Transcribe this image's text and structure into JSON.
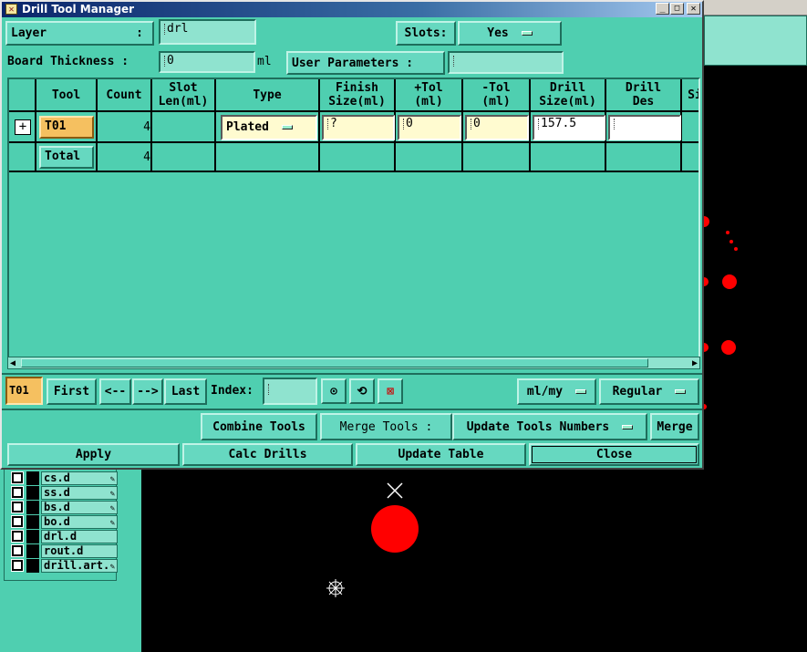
{
  "window": {
    "title": "Drill Tool Manager"
  },
  "top": {
    "layer_label": "Layer",
    "layer_colon": ":",
    "layer_value": "drl",
    "slots_label": "Slots:",
    "slots_value": "Yes",
    "board_thickness_label": "Board Thickness :",
    "board_thickness_value": "0",
    "board_thickness_unit": "ml",
    "user_params_label": "User Parameters :",
    "user_params_value": ""
  },
  "table": {
    "headers": [
      "Tool",
      "Count",
      "Slot\nLen(ml)",
      "Type",
      "Finish\nSize(ml)",
      "+Tol\n(ml)",
      "-Tol\n(ml)",
      "Drill\nSize(ml)",
      "Drill\nDes",
      "Si"
    ],
    "rows": [
      {
        "tool": "T01",
        "count": "4",
        "slot_len": "",
        "type": "Plated",
        "finish": "?",
        "plus_tol": "0",
        "minus_tol": "0",
        "drill_size": "157.5",
        "drill_des": ""
      },
      {
        "tool": "Total",
        "count": "4"
      }
    ]
  },
  "nav": {
    "current": "T01",
    "first": "First",
    "prev": "<--",
    "next": "-->",
    "last": "Last",
    "index_label": "Index:",
    "index_value": "",
    "units": "ml/my",
    "mode": "Regular"
  },
  "actions": {
    "combine_tools": "Combine Tools",
    "merge_tools_label": "Merge Tools :",
    "merge_tools_option": "Update Tools Numbers",
    "merge": "Merge",
    "apply": "Apply",
    "calc_drills": "Calc Drills",
    "update_table": "Update Table",
    "close": "Close"
  },
  "layers": [
    "cs.d",
    "ss.d",
    "bs.d",
    "bo.d",
    "drl.d",
    "rout.d",
    "drill.art."
  ],
  "colors": {
    "teal": "#4fcfb0",
    "canvas": "#000000",
    "pad_red": "#ff0000",
    "tool_orange": "#f5c060",
    "title_bar": "#0a246a"
  }
}
